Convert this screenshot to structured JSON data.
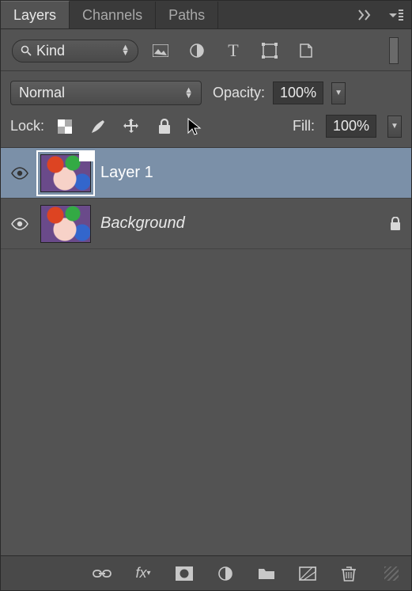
{
  "tabs": {
    "layers": "Layers",
    "channels": "Channels",
    "paths": "Paths"
  },
  "filter": {
    "kind_label": "Kind"
  },
  "blend": {
    "mode": "Normal",
    "opacity_label": "Opacity:",
    "opacity_value": "100%"
  },
  "lock": {
    "label": "Lock:",
    "fill_label": "Fill:",
    "fill_value": "100%"
  },
  "layers": [
    {
      "name": "Layer 1",
      "locked": false,
      "selected": true,
      "bg": false,
      "visible": true
    },
    {
      "name": "Background",
      "locked": true,
      "selected": false,
      "bg": true,
      "visible": true
    }
  ]
}
